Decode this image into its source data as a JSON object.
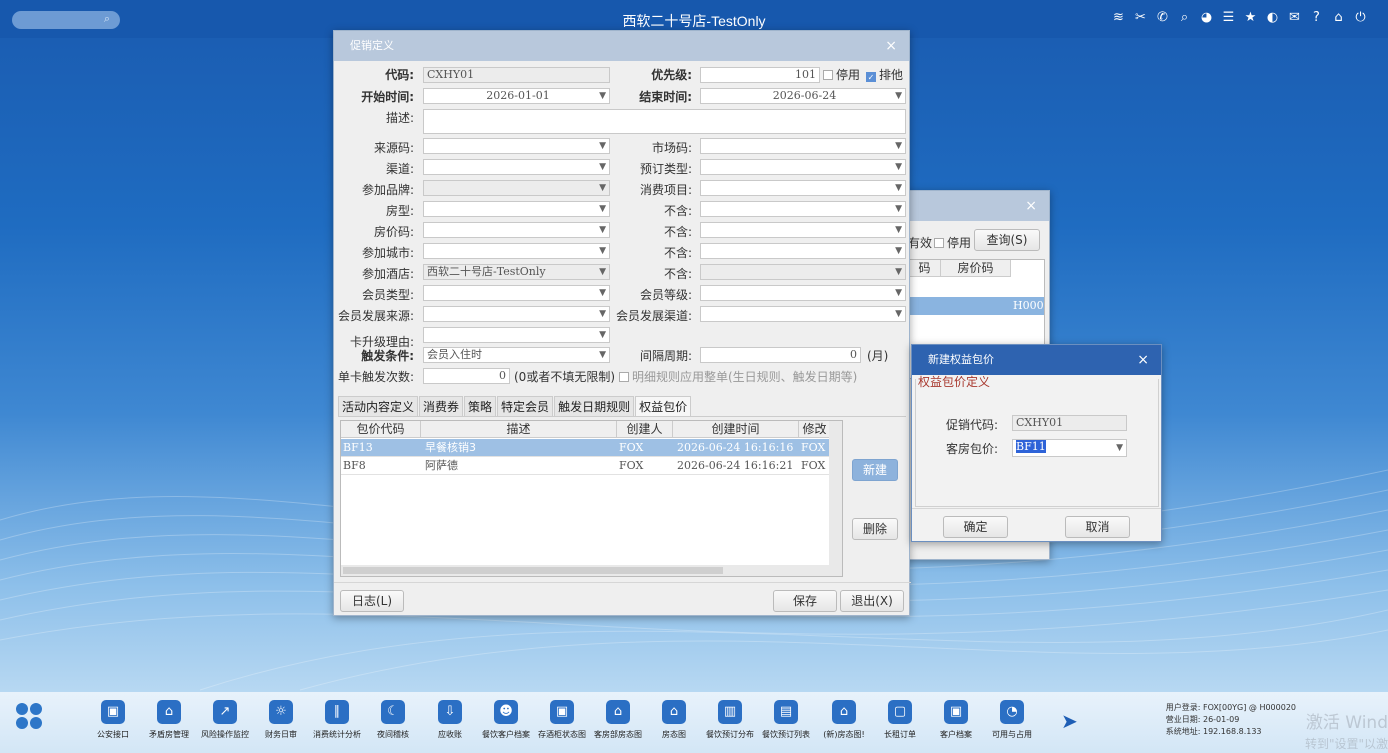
{
  "app": {
    "title": "西软二十号店-TestOnly"
  },
  "topbar": {
    "icons": [
      "wifi-icon",
      "tools-icon",
      "phone-icon",
      "search-user-icon",
      "palette-icon",
      "menu-icon",
      "star-icon",
      "contrast-icon",
      "mail-icon",
      "help-icon",
      "home-icon",
      "power-icon"
    ],
    "icon_glyphs": [
      "≋",
      "✂",
      "✆",
      "⌕",
      "◕",
      "☰",
      "★",
      "◐",
      "✉",
      "?",
      "⌂",
      "⏻"
    ]
  },
  "promo_dialog": {
    "title": "促销定义",
    "code_label": "代码:",
    "code_value": "CXHY01",
    "priority_label": "优先级:",
    "priority_value": "101",
    "disabled_label": "停用",
    "exclusive_label": "排他",
    "start_label": "开始时间:",
    "start_value": "2026-01-01",
    "end_label": "结束时间:",
    "end_value": "2026-06-24",
    "desc_label": "描述:",
    "source_label": "来源码:",
    "market_label": "市场码:",
    "channel_label": "渠道:",
    "booking_type_label": "预订类型:",
    "brand_label": "参加品牌:",
    "consume_label": "消费项目:",
    "room_type_label": "房型:",
    "exclude1_label": "不含:",
    "rate_label": "房价码:",
    "exclude2_label": "不含:",
    "city_label": "参加城市:",
    "exclude3_label": "不含:",
    "hotel_label": "参加酒店:",
    "hotel_value": "西软二十号店-TestOnly",
    "exclude4_label": "不含:",
    "member_type_label": "会员类型:",
    "member_level_label": "会员等级:",
    "member_source_label": "会员发展来源:",
    "member_channel_label": "会员发展渠道:",
    "upgrade_reason_label": "卡升级理由:",
    "trigger_label": "触发条件:",
    "trigger_value": "会员入住时",
    "interval_label": "间隔周期:",
    "interval_value": "0",
    "interval_unit": "(月)",
    "card_trigger_label": "单卡触发次数:",
    "card_trigger_value": "0",
    "card_trigger_hint": "(0或者不填无限制)",
    "detail_rule_label": "明细规则应用整单(生日规则、触发日期等)",
    "tabs": [
      "活动内容定义",
      "消费券",
      "策略",
      "特定会员",
      "触发日期规则",
      "权益包价"
    ],
    "grid_headers": [
      "包价代码",
      "描述",
      "创建人",
      "创建时间",
      "修改"
    ],
    "rows": [
      {
        "code": "BF13",
        "desc": "早餐核销3",
        "creator": "FOX",
        "time": "2026-06-24 16:16:16",
        "mod": "FOX"
      },
      {
        "code": "BF8",
        "desc": "阿萨德",
        "creator": "FOX",
        "time": "2026-06-24 16:16:21",
        "mod": "FOX"
      }
    ],
    "new_button": "新建",
    "delete_button": "删除",
    "log_button": "日志(L)",
    "save_button": "保存",
    "exit_button": "退出(X)"
  },
  "bg_dialog": {
    "effective_label": "有效",
    "disabled_label": "停用",
    "query_button": "查询(S)",
    "col1": "码",
    "col2": "房价码",
    "cell": "H000"
  },
  "pkg_dialog": {
    "title": "新建权益包价",
    "section": "权益包价定义",
    "promo_label": "促销代码:",
    "promo_value": "CXHY01",
    "room_pkg_label": "客房包价:",
    "room_pkg_value": "BF11",
    "ok_button": "确定",
    "cancel_button": "取消"
  },
  "taskbar": {
    "items": [
      {
        "label": "公安接口",
        "glyph": "▣"
      },
      {
        "label": "矛盾房管理",
        "glyph": "⌂"
      },
      {
        "label": "风险操作监控",
        "glyph": "↗"
      },
      {
        "label": "财务日审",
        "glyph": "☼"
      },
      {
        "label": "消费统计分析",
        "glyph": "∥"
      },
      {
        "label": "夜间稽核",
        "glyph": "☾"
      },
      {
        "label": "应收账",
        "glyph": "⇩"
      },
      {
        "label": "餐饮客户档案",
        "glyph": "☻"
      },
      {
        "label": "存酒柜状态图",
        "glyph": "▣"
      },
      {
        "label": "客房部房态图",
        "glyph": "⌂"
      },
      {
        "label": "房态图",
        "glyph": "⌂"
      },
      {
        "label": "餐饮预订分布",
        "glyph": "▥"
      },
      {
        "label": "餐饮预订列表",
        "glyph": "▤"
      },
      {
        "label": "(新)房态图!",
        "glyph": "⌂"
      },
      {
        "label": "长租订单",
        "glyph": "▢"
      },
      {
        "label": "客户档案",
        "glyph": "▣"
      },
      {
        "label": "可用与占用",
        "glyph": "◔"
      }
    ],
    "user_label": "用户登录:",
    "user_value": "FOX[00YG] @ H000020",
    "date_label": "营业日期:",
    "date_value": "26-01-09",
    "addr_label": "系统地址:",
    "addr_value": "192.168.8.133"
  },
  "watermark": {
    "line1": "激活 Wind",
    "line2": "转到\"设置\"以激"
  }
}
